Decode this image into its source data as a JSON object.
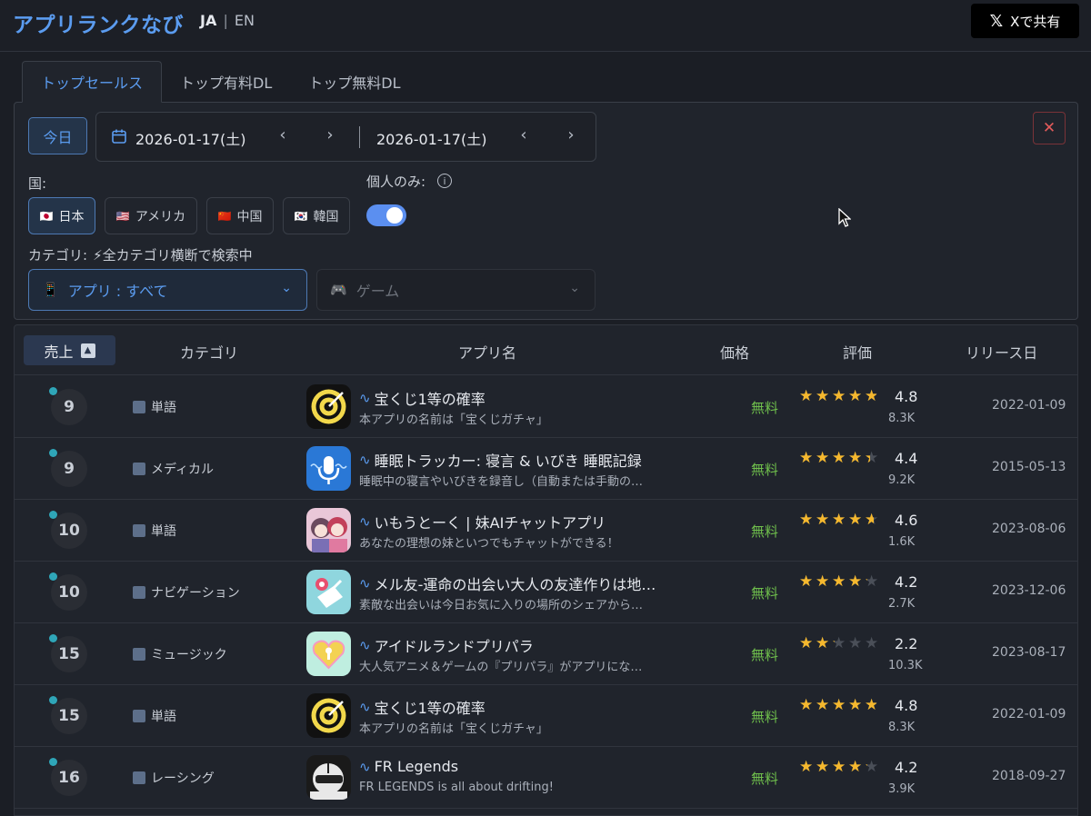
{
  "header": {
    "brand": "アプリランクなび",
    "lang_ja": "JA",
    "lang_sep": "|",
    "lang_en": "EN",
    "share_label": "Xで共有",
    "share_icon": "x-logo-icon"
  },
  "tabs": [
    {
      "label": "トップセールス",
      "active": true
    },
    {
      "label": "トップ有料DL",
      "active": false
    },
    {
      "label": "トップ無料DL",
      "active": false
    }
  ],
  "filters": {
    "today_label": "今日",
    "date_from": "2026-01-17(土)",
    "date_to": "2026-01-17(土)",
    "prev_glyph": "‹",
    "next_glyph": "›",
    "close_glyph": "✕",
    "country_label": "国:",
    "countries": [
      {
        "flag": "🇯🇵",
        "label": "日本",
        "selected": true
      },
      {
        "flag": "🇺🇸",
        "label": "アメリカ",
        "selected": false
      },
      {
        "flag": "🇨🇳",
        "label": "中国",
        "selected": false
      },
      {
        "flag": "🇰🇷",
        "label": "韓国",
        "selected": false
      }
    ],
    "individual_label": "個人のみ:",
    "individual_on": true,
    "category_label": "カテゴリ:",
    "category_status": "⚡全カテゴリ横断で検索中",
    "app_select": "アプリ : すべて",
    "game_select": "ゲーム"
  },
  "table": {
    "headers": {
      "sales": "売上",
      "category": "カテゴリ",
      "app_name": "アプリ名",
      "price": "価格",
      "rating": "評価",
      "release": "リリース日"
    },
    "rows": [
      {
        "rank": "9",
        "category": "単語",
        "name": "宝くじ1等の確率",
        "desc": "本アプリの名前は「宝くじガチャ」",
        "price": "無料",
        "rating": 4.8,
        "rating_text": "4.8",
        "count": "8.3K",
        "release": "2022-01-09",
        "icon": "target-icon"
      },
      {
        "rank": "9",
        "category": "メディカル",
        "name": "睡眠トラッカー: 寝言 & いびき 睡眠記録",
        "desc": "睡眠中の寝言やいびきを録音し（自動または手動の…",
        "price": "無料",
        "rating": 4.4,
        "rating_text": "4.4",
        "count": "9.2K",
        "release": "2015-05-13",
        "icon": "microphone-icon"
      },
      {
        "rank": "10",
        "category": "単語",
        "name": "いもうとーく | 妹AIチャットアプリ",
        "desc": "あなたの理想の妹といつでもチャットができる！",
        "price": "無料",
        "rating": 4.6,
        "rating_text": "4.6",
        "count": "1.6K",
        "release": "2023-08-06",
        "icon": "anime-girls-icon"
      },
      {
        "rank": "10",
        "category": "ナビゲーション",
        "name": "メル友-運命の出会い大人の友達作りは地…",
        "desc": "素敵な出会いは今日お気に入りの場所のシェアから…",
        "price": "無料",
        "rating": 4.2,
        "rating_text": "4.2",
        "count": "2.7K",
        "release": "2023-12-06",
        "icon": "map-pin-icon"
      },
      {
        "rank": "15",
        "category": "ミュージック",
        "name": "アイドルランドプリパラ",
        "desc": "大人気アニメ＆ゲームの『プリパラ』がアプリにな…",
        "price": "無料",
        "rating": 2.2,
        "rating_text": "2.2",
        "count": "10.3K",
        "release": "2023-08-17",
        "icon": "heart-key-icon"
      },
      {
        "rank": "15",
        "category": "単語",
        "name": "宝くじ1等の確率",
        "desc": "本アプリの名前は「宝くじガチャ」",
        "price": "無料",
        "rating": 4.8,
        "rating_text": "4.8",
        "count": "8.3K",
        "release": "2022-01-09",
        "icon": "target-icon"
      },
      {
        "rank": "16",
        "category": "レーシング",
        "name": "FR Legends",
        "desc": "FR LEGENDS is all about drifting!",
        "price": "無料",
        "rating": 4.2,
        "rating_text": "4.2",
        "count": "3.9K",
        "release": "2018-09-27",
        "icon": "racing-helmet-icon"
      }
    ]
  },
  "colors": {
    "accent": "#5b9cf0",
    "free": "#6fbf4c",
    "star": "#f5b82e",
    "danger": "#e35b5b"
  }
}
